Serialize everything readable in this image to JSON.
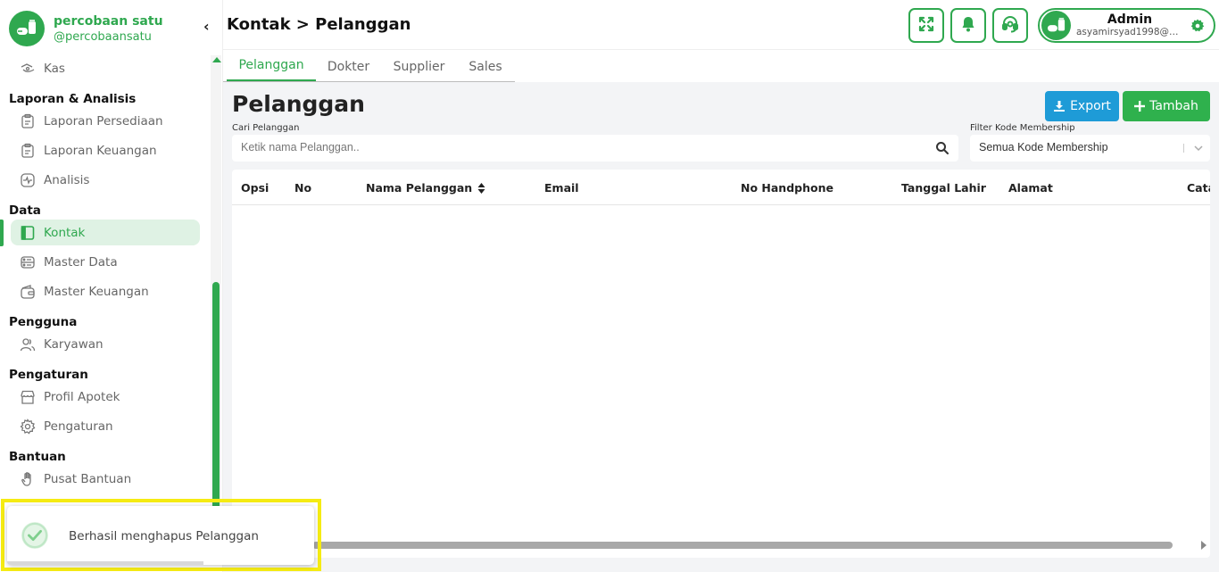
{
  "brand": {
    "name": "percobaan satu",
    "handle": "@percobaansatu"
  },
  "sidebar": {
    "collapse_glyph": "‹",
    "items": [
      {
        "type": "item",
        "label": "Kas",
        "icon": "cash-icon"
      },
      {
        "type": "section",
        "label": "Laporan & Analisis"
      },
      {
        "type": "item",
        "label": "Laporan Persediaan",
        "icon": "clipboard-icon"
      },
      {
        "type": "item",
        "label": "Laporan Keuangan",
        "icon": "clipboard-icon"
      },
      {
        "type": "item",
        "label": "Analisis",
        "icon": "pulse-icon"
      },
      {
        "type": "section",
        "label": "Data"
      },
      {
        "type": "item",
        "label": "Kontak",
        "icon": "contact-book-icon",
        "active": true
      },
      {
        "type": "item",
        "label": "Master Data",
        "icon": "database-icon"
      },
      {
        "type": "item",
        "label": "Master Keuangan",
        "icon": "wallet-icon"
      },
      {
        "type": "section",
        "label": "Pengguna"
      },
      {
        "type": "item",
        "label": "Karyawan",
        "icon": "users-icon"
      },
      {
        "type": "section",
        "label": "Pengaturan"
      },
      {
        "type": "item",
        "label": "Profil Apotek",
        "icon": "store-icon"
      },
      {
        "type": "item",
        "label": "Pengaturan",
        "icon": "gear-icon"
      },
      {
        "type": "section",
        "label": "Bantuan"
      },
      {
        "type": "item",
        "label": "Pusat Bantuan",
        "icon": "hand-icon"
      }
    ]
  },
  "header": {
    "breadcrumb": "Kontak > Pelanggan",
    "buttons": [
      "fullscreen-icon",
      "bell-icon",
      "headset-icon"
    ],
    "user": {
      "name": "Admin",
      "email": "asyamirsyad1998@g..."
    }
  },
  "tabs": [
    {
      "label": "Pelanggan",
      "active": true
    },
    {
      "label": "Dokter",
      "active": false
    },
    {
      "label": "Supplier",
      "active": false
    },
    {
      "label": "Sales",
      "active": false
    }
  ],
  "main": {
    "title": "Pelanggan",
    "export_label": "Export",
    "tambah_label": "Tambah",
    "search_label": "Cari Pelanggan",
    "search_placeholder": "Ketik nama Pelanggan..",
    "filter_label": "Filter Kode Membership",
    "filter_value": "Semua Kode Membership"
  },
  "table": {
    "columns": [
      "Opsi",
      "No",
      "Nama Pelanggan",
      "Email",
      "No Handphone",
      "Tanggal Lahir",
      "Alamat",
      "Cata"
    ],
    "rows": []
  },
  "toast": {
    "message": "Berhasil menghapus Pelanggan"
  },
  "colors": {
    "primary": "#2fa84f",
    "export": "#1e9bd7",
    "highlight": "#f5eb13"
  }
}
